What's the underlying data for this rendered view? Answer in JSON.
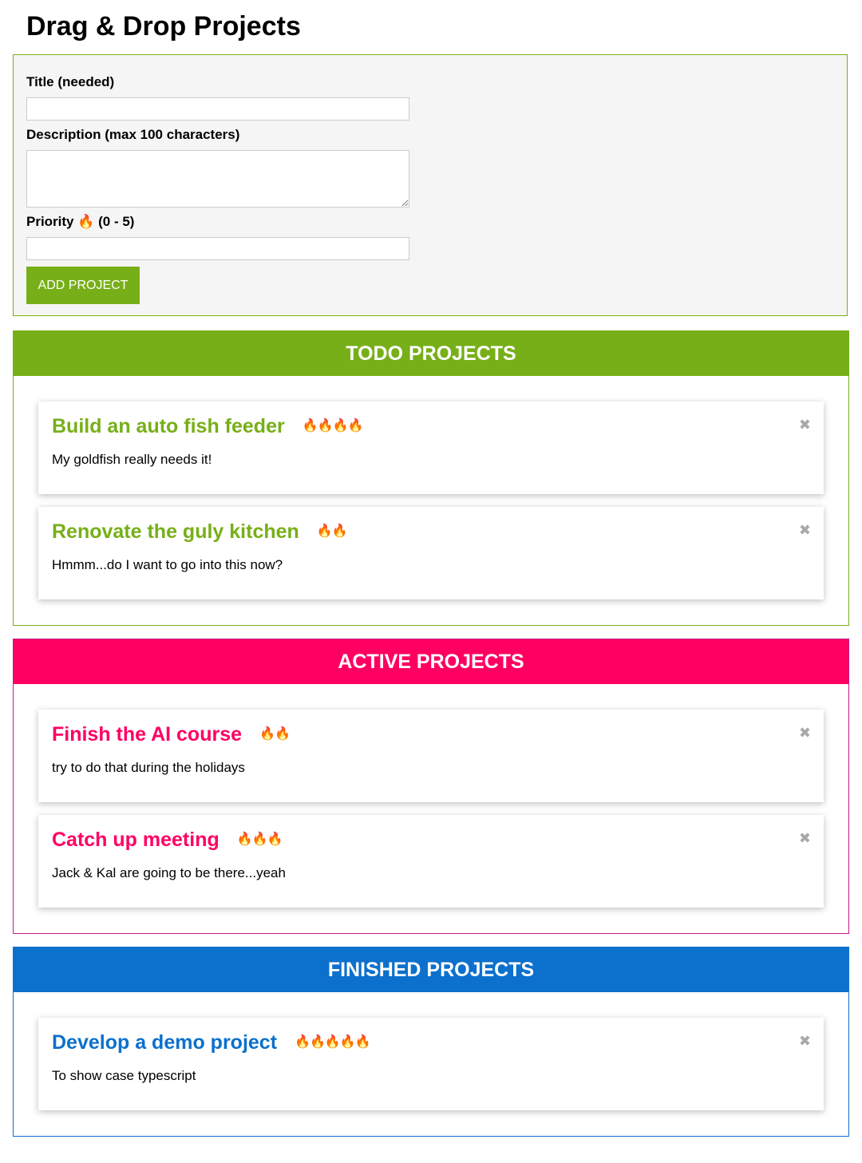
{
  "page": {
    "title": "Drag & Drop Projects"
  },
  "form": {
    "title_label": "Title (needed)",
    "title_value": "",
    "description_label": "Description (max 100 characters)",
    "description_value": "",
    "priority_label": "Priority 🔥 (0 - 5)",
    "priority_value": "",
    "submit_label": "ADD PROJECT"
  },
  "colors": {
    "todo": "#77af18",
    "active": "#ff0062",
    "finished": "#0c70cd",
    "close_icon": "#a8a8a8"
  },
  "sections": {
    "todo": {
      "header": "TODO PROJECTS",
      "projects": [
        {
          "title": "Build an auto fish feeder",
          "priority": 4,
          "flames": "🔥🔥🔥🔥",
          "description": "My goldfish really needs it!",
          "close_icon": "✖"
        },
        {
          "title": "Renovate the guly kitchen",
          "priority": 2,
          "flames": "🔥🔥",
          "description": "Hmmm...do I want to go into this now?",
          "close_icon": "✖"
        }
      ]
    },
    "active": {
      "header": "ACTIVE PROJECTS",
      "projects": [
        {
          "title": "Finish the AI course",
          "priority": 2,
          "flames": "🔥🔥",
          "description": "try to do that during the holidays",
          "close_icon": "✖"
        },
        {
          "title": "Catch up meeting",
          "priority": 3,
          "flames": "🔥🔥🔥",
          "description": "Jack & Kal are going to be there...yeah",
          "close_icon": "✖"
        }
      ]
    },
    "finished": {
      "header": "FINISHED PROJECTS",
      "projects": [
        {
          "title": "Develop a demo project",
          "priority": 5,
          "flames": "🔥🔥🔥🔥🔥",
          "description": "To show case typescript",
          "close_icon": "✖"
        }
      ]
    }
  }
}
